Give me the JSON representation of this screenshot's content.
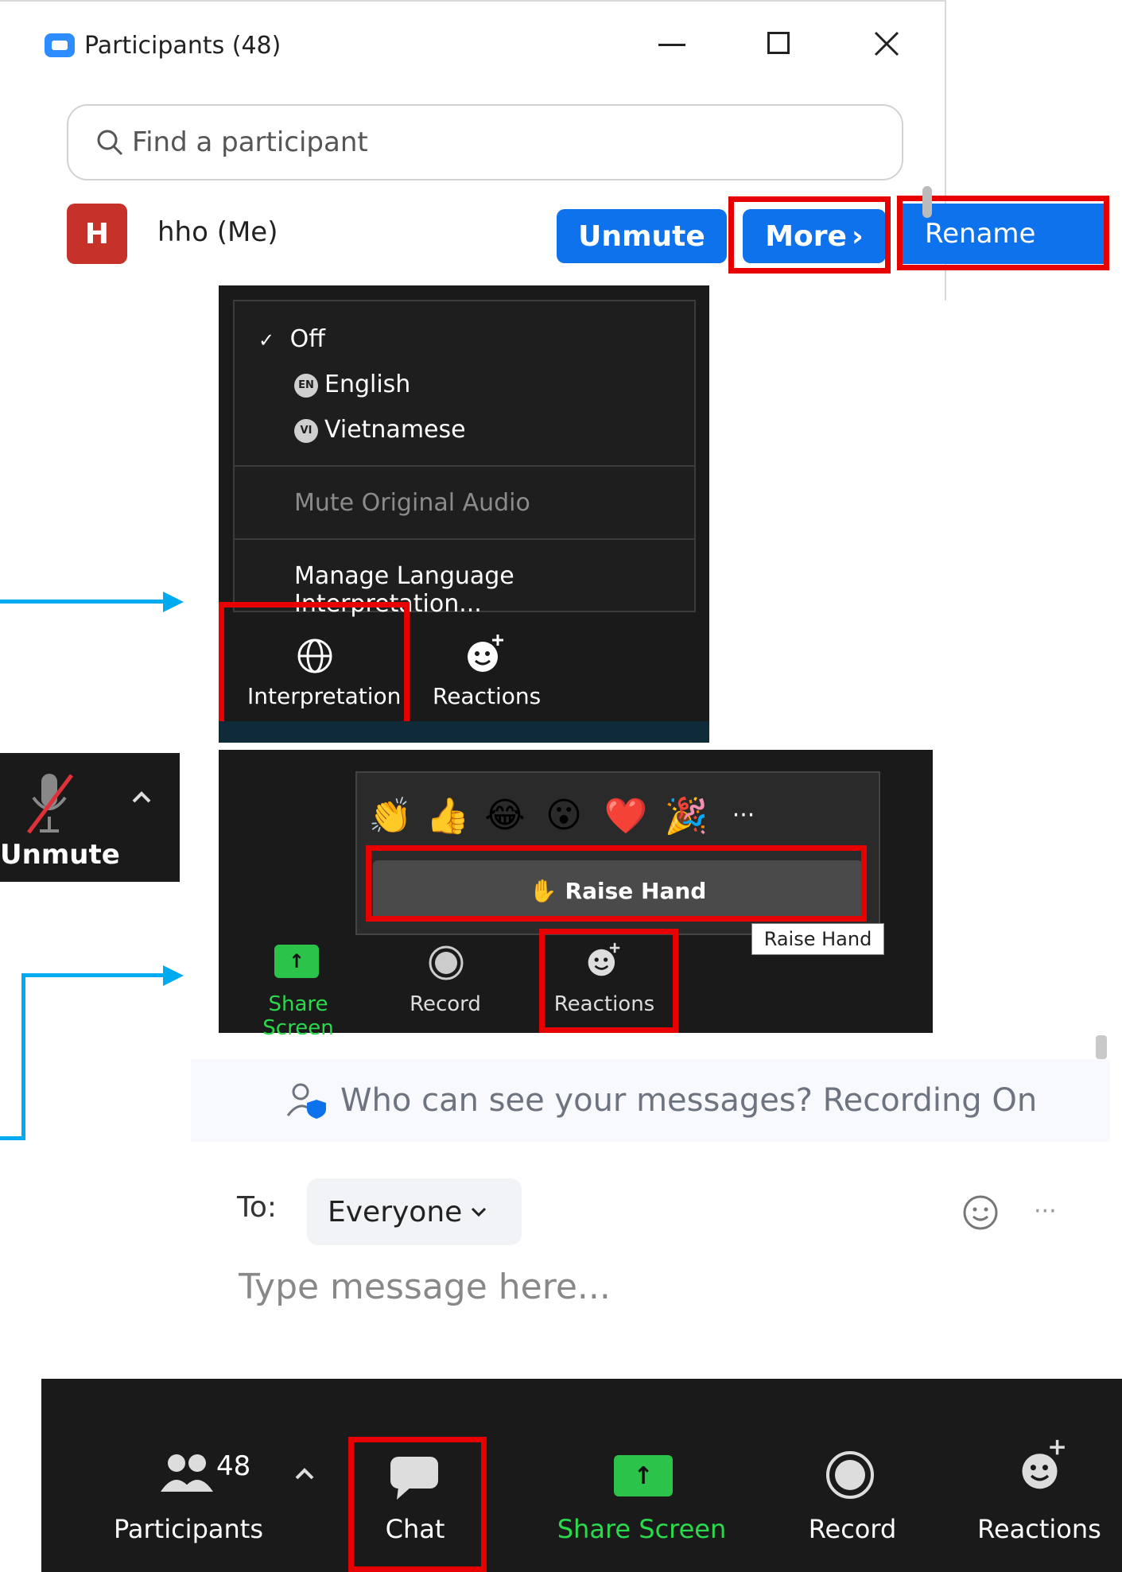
{
  "participants_window": {
    "title": "Participants (48)",
    "search_placeholder": "Find a participant",
    "me": {
      "initial": "H",
      "name": "hho (Me)",
      "unmute_label": "Unmute",
      "more_label": "More",
      "more_chevron": "›",
      "rename_label": "Rename"
    },
    "icons": [
      "zoom-logo-icon",
      "minimize-icon",
      "maximize-icon",
      "close-icon",
      "search-icon"
    ]
  },
  "interpretation_panel": {
    "menu": {
      "off_label": "Off",
      "checkmark": "✓",
      "languages": [
        {
          "badge": "EN",
          "label": "English"
        },
        {
          "badge": "VI",
          "label": "Vietnamese"
        }
      ],
      "mute_original_label": "Mute Original Audio",
      "manage_label": "Manage Language Interpretation..."
    },
    "toolbar": {
      "interpretation_label": "Interpretation",
      "reactions_label": "Reactions"
    }
  },
  "unmute_snippet": {
    "label": "Unmute"
  },
  "reactions_panel": {
    "emojis": [
      "👏",
      "👍",
      "😂",
      "😮",
      "❤️",
      "🎉"
    ],
    "more_label": "···",
    "raise_hand_icon": "✋",
    "raise_hand_label": "Raise Hand",
    "tooltip_label": "Raise Hand",
    "toolbar": {
      "share_screen_label": "Share Screen",
      "record_label": "Record",
      "reactions_label": "Reactions"
    }
  },
  "chat": {
    "banner_text": "Who can see your messages? Recording On",
    "to_label": "To:",
    "recipient": "Everyone",
    "message_placeholder": "Type message here..."
  },
  "bottom_toolbar": {
    "participants_label": "Participants",
    "participants_count": "48",
    "chat_label": "Chat",
    "share_screen_label": "Share Screen",
    "record_label": "Record",
    "reactions_label": "Reactions"
  },
  "colors": {
    "zoom_blue": "#0e72ed",
    "highlight_red": "#e60000",
    "connector_blue": "#00aaee",
    "share_green": "#2bd94c",
    "toolbar_dark": "#1a1a1a"
  }
}
